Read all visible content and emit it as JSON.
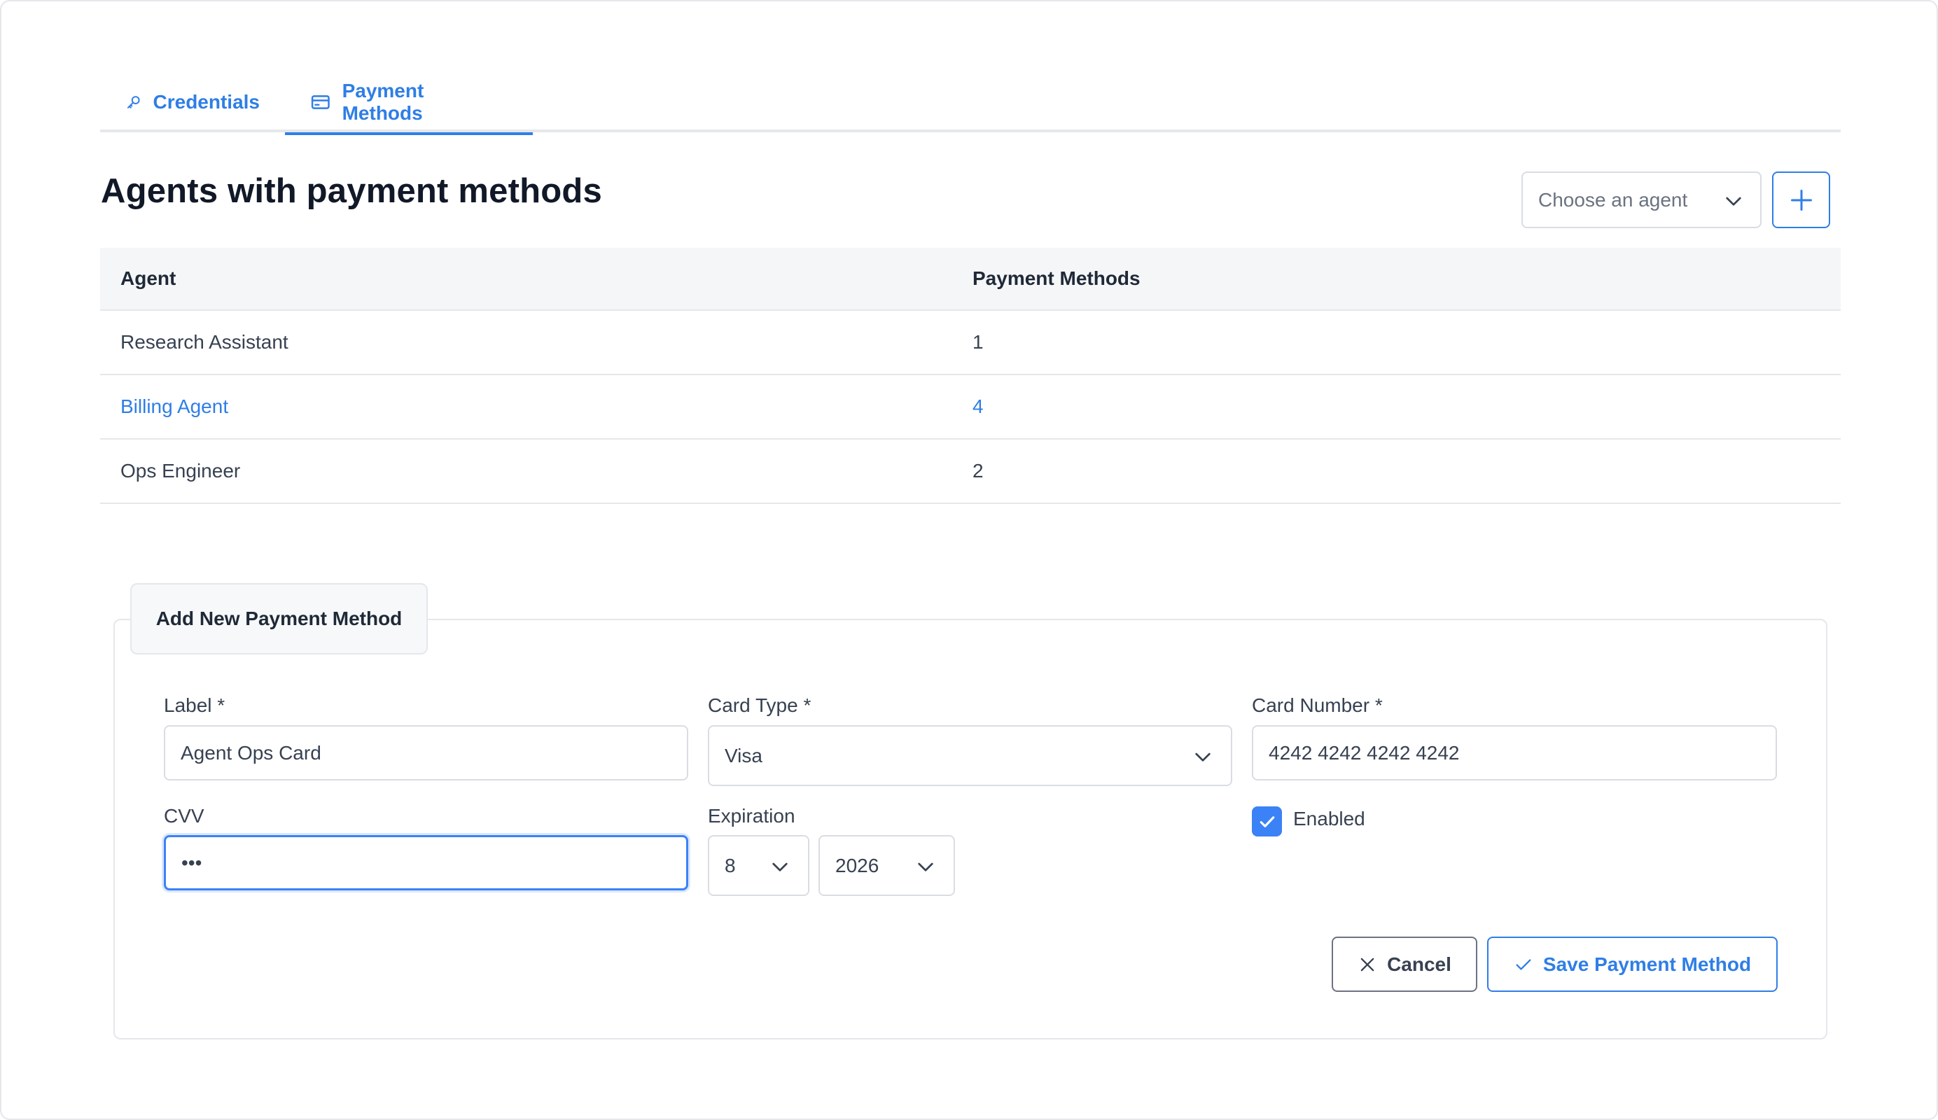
{
  "tabs": [
    {
      "label": "Credentials",
      "icon": "key-icon"
    },
    {
      "label": "Payment Methods",
      "icon": "credit-card-icon"
    }
  ],
  "active_tab": "Payment Methods",
  "page": {
    "title": "Agents with payment methods",
    "agent_select_placeholder": "Choose an agent"
  },
  "table": {
    "headers": {
      "agent": "Agent",
      "payment_methods": "Payment Methods"
    },
    "rows": [
      {
        "agent": "Research Assistant",
        "payment_methods": "1"
      },
      {
        "agent": "Billing Agent",
        "payment_methods": "4"
      },
      {
        "agent": "Ops Engineer",
        "payment_methods": "2"
      }
    ]
  },
  "form": {
    "title": "Add New Payment Method",
    "label_field": {
      "label": "Label *",
      "value": "Agent Ops Card"
    },
    "card_type_field": {
      "label": "Card Type *",
      "value": "Visa"
    },
    "card_number_field": {
      "label": "Card Number *",
      "value": "4242 4242 4242 4242"
    },
    "cvv_field": {
      "label": "CVV",
      "value": "•••"
    },
    "expiration": {
      "label": "Expiration",
      "month": "8",
      "year": "2026"
    },
    "enabled": {
      "label": "Enabled",
      "checked": true
    },
    "cancel_label": "Cancel",
    "save_label": "Save Payment Method"
  },
  "colors": {
    "accent": "#2f7ee6",
    "checkbox": "#3b82f6",
    "border": "#e5e7eb"
  }
}
